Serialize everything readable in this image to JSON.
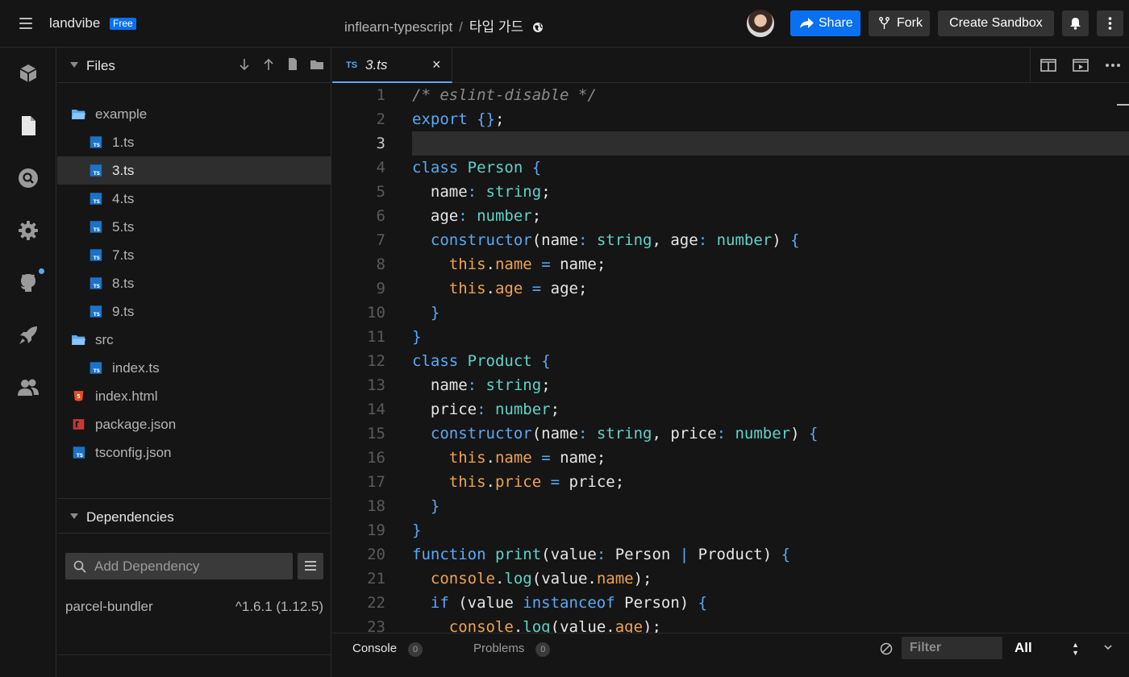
{
  "header": {
    "brand": "landvibe",
    "badge": "Free",
    "sandbox_folder": "inflearn-typescript",
    "separator": "/",
    "sandbox_title": "타입 가드",
    "share_label": "Share",
    "fork_label": "Fork",
    "create_label": "Create Sandbox"
  },
  "activity_bar": {
    "items": [
      "box-icon",
      "file-icon",
      "search-icon",
      "gear-icon",
      "github-icon",
      "rocket-icon",
      "users-icon"
    ]
  },
  "sidebar": {
    "files_label": "Files",
    "tree": [
      {
        "name": "example",
        "type": "folder",
        "depth": 0
      },
      {
        "name": "1.ts",
        "type": "ts",
        "depth": 1
      },
      {
        "name": "3.ts",
        "type": "ts",
        "depth": 1,
        "active": true
      },
      {
        "name": "4.ts",
        "type": "ts",
        "depth": 1
      },
      {
        "name": "5.ts",
        "type": "ts",
        "depth": 1
      },
      {
        "name": "7.ts",
        "type": "ts",
        "depth": 1
      },
      {
        "name": "8.ts",
        "type": "ts",
        "depth": 1
      },
      {
        "name": "9.ts",
        "type": "ts",
        "depth": 1
      },
      {
        "name": "src",
        "type": "folder",
        "depth": 0
      },
      {
        "name": "index.ts",
        "type": "ts",
        "depth": 1
      },
      {
        "name": "index.html",
        "type": "html",
        "depth": 0
      },
      {
        "name": "package.json",
        "type": "npm",
        "depth": 0
      },
      {
        "name": "tsconfig.json",
        "type": "ts",
        "depth": 0
      }
    ],
    "dependencies_label": "Dependencies",
    "dependency_placeholder": "Add Dependency",
    "dependencies": [
      {
        "name": "parcel-bundler",
        "version": "^1.6.1 (1.12.5)"
      }
    ]
  },
  "editor": {
    "tab_lang": "TS",
    "tab_name": "3.ts",
    "tab_close": "×",
    "current_line": 3,
    "lines": [
      "/* eslint-disable */",
      "export {};",
      "",
      "class Person {",
      "  name: string;",
      "  age: number;",
      "  constructor(name: string, age: number) {",
      "    this.name = name;",
      "    this.age = age;",
      "  }",
      "}",
      "class Product {",
      "  name: string;",
      "  price: number;",
      "  constructor(name: string, price: number) {",
      "    this.name = name;",
      "    this.price = price;",
      "  }",
      "}",
      "function print(value: Person | Product) {",
      "  console.log(value.name);",
      "  if (value instanceof Person) {",
      "    console.log(value.age);"
    ]
  },
  "bottom_panel": {
    "console_label": "Console",
    "console_count": "0",
    "problems_label": "Problems",
    "problems_count": "0",
    "filter_placeholder": "Filter",
    "level_value": "All"
  },
  "colors": {
    "accent": "#0971f1",
    "background": "#151515",
    "keyword": "#5aa9f6",
    "type": "#5fd3c9",
    "property": "#f0a351",
    "comment": "#8a8a8a"
  }
}
